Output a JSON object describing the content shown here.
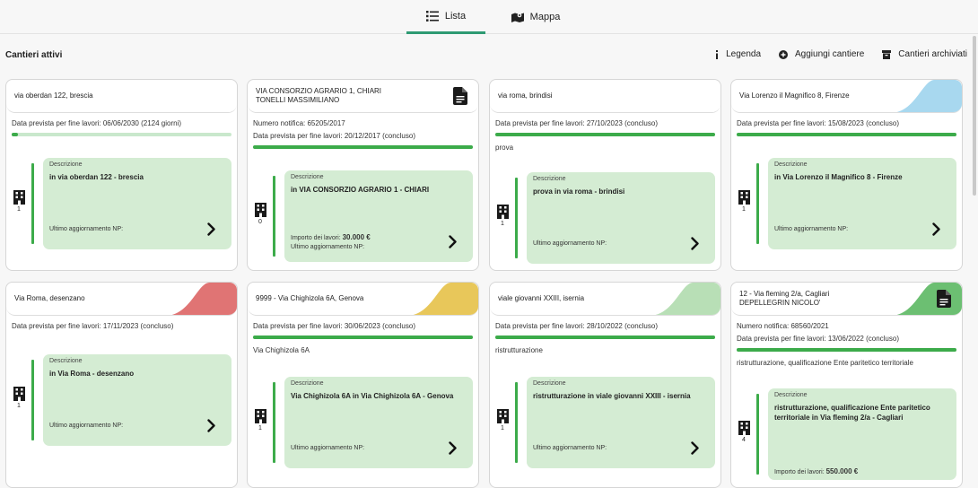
{
  "tabs": [
    {
      "label": "Lista",
      "icon": "list-icon"
    },
    {
      "label": "Mappa",
      "icon": "map-icon"
    }
  ],
  "toolbar": {
    "title": "Cantieri attivi",
    "legend_label": "Legenda",
    "add_label": "Aggiungi cantiere",
    "archive_label": "Cantieri archiviati"
  },
  "cards": [
    {
      "address": "via oberdan 122, brescia",
      "corner_color": "#ffffff",
      "notifica": "",
      "fine_lavori": "Data prevista per fine lavori: 06/06/2030 (2124 giorni)",
      "progress": 0.03,
      "note": "",
      "workers": "1",
      "desc_label": "Descrizione",
      "desc": "in via oberdan 122 - brescia",
      "importo_label": "",
      "importo_value": "",
      "ultimo": "Ultimo aggiornamento NP:"
    },
    {
      "address": "VIA CONSORZIO AGRARIO 1, CHIARI",
      "address2": "TONELLI MASSIMILIANO",
      "corner_color": "#ffffff",
      "doc": true,
      "notifica": "Numero notifica: 65205/2017",
      "fine_lavori": "Data prevista per fine lavori: 20/12/2017 (concluso)",
      "progress": 1,
      "note": "",
      "workers": "0",
      "desc_label": "Descrizione",
      "desc": "in VIA CONSORZIO AGRARIO 1 - CHIARI",
      "importo_label": "Importo dei lavori:",
      "importo_value": "30.000 €",
      "ultimo": "Ultimo aggiornamento NP:"
    },
    {
      "address": "via roma, brindisi",
      "corner_color": "#ffffff",
      "notifica": "",
      "fine_lavori": "Data prevista per fine lavori: 27/10/2023 (concluso)",
      "progress": 1,
      "note": "prova",
      "workers": "1",
      "desc_label": "Descrizione",
      "desc": "prova in via roma - brindisi",
      "importo_label": "",
      "importo_value": "",
      "ultimo": "Ultimo aggiornamento NP:"
    },
    {
      "address": "Via Lorenzo il Magnifico 8, Firenze",
      "corner_color": "#a8d8ef",
      "notifica": "",
      "fine_lavori": "Data prevista per fine lavori: 15/08/2023 (concluso)",
      "progress": 1,
      "note": "",
      "workers": "1",
      "desc_label": "Descrizione",
      "desc": "in Via Lorenzo il Magnifico 8 - Firenze",
      "importo_label": "",
      "importo_value": "",
      "ultimo": "Ultimo aggiornamento NP:"
    },
    {
      "address": "Via Roma, desenzano",
      "corner_color": "#e07474",
      "notifica": "",
      "fine_lavori": "Data prevista per fine lavori: 17/11/2023 (concluso)",
      "progress": -1,
      "note": "",
      "workers": "1",
      "desc_label": "Descrizione",
      "desc": "in Via Roma - desenzano",
      "importo_label": "",
      "importo_value": "",
      "ultimo": "Ultimo aggiornamento NP:"
    },
    {
      "address": "9999 - Via Chighizola 6A, Genova",
      "corner_color": "#e8c75a",
      "notifica": "",
      "fine_lavori": "Data prevista per fine lavori: 30/06/2023 (concluso)",
      "progress": 1,
      "note": "Via Chighizola 6A",
      "workers": "1",
      "desc_label": "Descrizione",
      "desc": "Via Chighizola 6A in Via Chighizola 6A - Genova",
      "importo_label": "",
      "importo_value": "",
      "ultimo": "Ultimo aggiornamento NP:"
    },
    {
      "address": "viale giovanni XXIII, isernia",
      "corner_color": "#b8dfb6",
      "notifica": "",
      "fine_lavori": "Data prevista per fine lavori: 28/10/2022 (concluso)",
      "progress": 1,
      "note": "ristrutturazione",
      "workers": "1",
      "desc_label": "Descrizione",
      "desc": "ristrutturazione in viale giovanni XXIII - isernia",
      "importo_label": "",
      "importo_value": "",
      "ultimo": "Ultimo aggiornamento NP:"
    },
    {
      "address": "12 - Via fleming 2/a, Cagliari",
      "address2": "DEPELLEGRIN NICOLO'",
      "corner_color": "#6cbf72",
      "doc": true,
      "notifica": "Numero notifica: 68560/2021",
      "fine_lavori": "Data prevista per fine lavori: 13/06/2022 (concluso)",
      "progress": 1,
      "note": "ristrutturazione, qualificazione Ente paritetico territoriale",
      "workers": "4",
      "desc_label": "Descrizione",
      "desc": "ristrutturazione, qualificazione Ente paritetico territoriale in Via fleming 2/a - Cagliari",
      "importo_label": "Importo dei lavori:",
      "importo_value": "550.000 €",
      "ultimo": ""
    }
  ]
}
